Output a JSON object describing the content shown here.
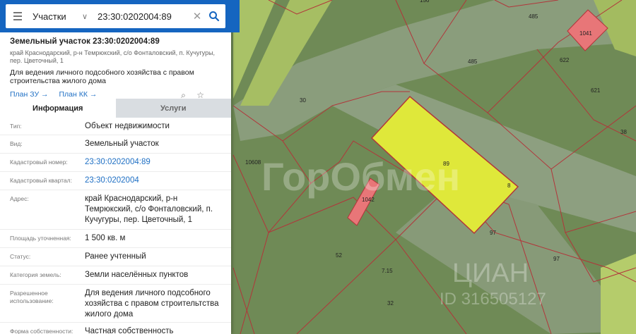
{
  "search": {
    "category": "Участки",
    "query": "23:30:0202004:89"
  },
  "parcel": {
    "title": "Земельный участок 23:30:0202004:89",
    "address_short": "край Краснодарский, р-н Темрюкский, с/о Фонталовский, п. Кучугуры, пер. Цветочный, 1",
    "purpose": "Для ведения личного подсобного хозяйства с правом строительства жилого дома",
    "links": [
      "План ЗУ →",
      "План КК →"
    ]
  },
  "tabs": [
    {
      "label": "Информация",
      "active": true
    },
    {
      "label": "Услуги",
      "active": false
    }
  ],
  "rows": [
    {
      "label": "Тип:",
      "value": "Объект недвижимости"
    },
    {
      "label": "Вид:",
      "value": "Земельный участок"
    },
    {
      "label": "Кадастровый номер:",
      "value": "23:30:0202004:89",
      "link": true
    },
    {
      "label": "Кадастровый квартал:",
      "value": "23:30:0202004",
      "link": true
    },
    {
      "label": "Адрес:",
      "value": "край Краснодарский, р-н Темрюкский, с/о Фонталовский, п. Кучугуры, пер. Цветочный, 1"
    },
    {
      "label": "Площадь уточненная:",
      "value": "1 500 кв. м"
    },
    {
      "label": "Статус:",
      "value": "Ранее учтенный"
    },
    {
      "label": "Категория земель:",
      "value": "Земли населённых пунктов"
    },
    {
      "label": "Разрешенное использование:",
      "value": "Для ведения личного подсобного хозяйства с правом строительтства жилого дома"
    },
    {
      "label": "Форма собственности:",
      "value": "Частная собственность"
    }
  ],
  "map": {
    "labels": [
      "156",
      "485",
      "485",
      "1041",
      "622",
      "621",
      "30",
      "38",
      "10608",
      "89",
      "8",
      "1042",
      "97",
      "97",
      "52",
      "7.15",
      "32"
    ],
    "watermark": "ГорОбмен",
    "watermark2": "ЦИАН",
    "watermark2_id": "ID 316505127",
    "parcel_color": "#dfe83a",
    "accent": "#1565c0"
  }
}
